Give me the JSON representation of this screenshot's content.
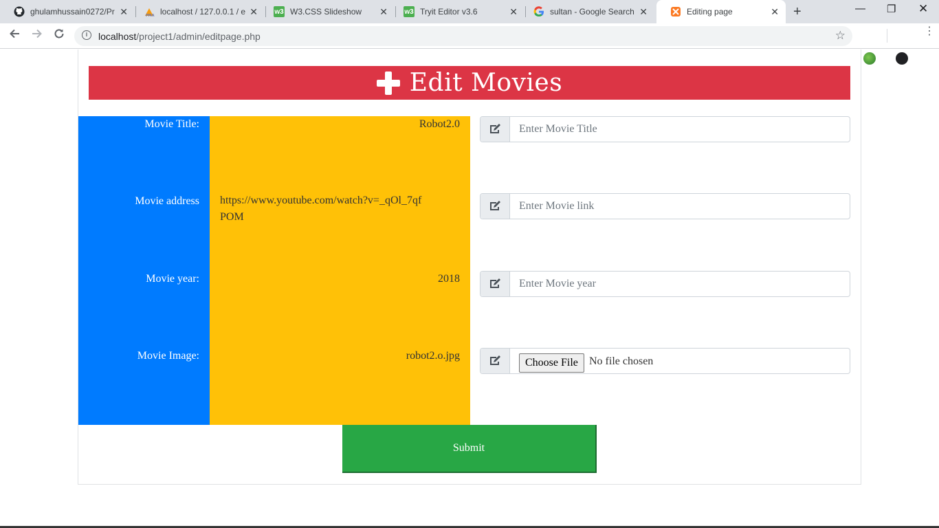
{
  "browser": {
    "tabs": [
      {
        "title": "ghulamhussain0272/Pr",
        "icon": "github-icon"
      },
      {
        "title": "localhost / 127.0.0.1 / e",
        "icon": "phpmyadmin-icon"
      },
      {
        "title": "W3.CSS Slideshow",
        "icon": "w3-icon"
      },
      {
        "title": "Tryit Editor v3.6",
        "icon": "w3-icon"
      },
      {
        "title": "sultan - Google Search",
        "icon": "google-icon"
      },
      {
        "title": "Editing page",
        "icon": "xampp-icon",
        "active": true
      }
    ],
    "url_host": "localhost",
    "url_path": "/project1/admin/editpage.php"
  },
  "page": {
    "heading": "Edit Movies",
    "fields": {
      "title_label": "Movie Title:",
      "title_value": "Robot2.0",
      "title_placeholder": "Enter Movie Title",
      "address_label": "Movie address",
      "address_value": "https://www.youtube.com/watch?v=_qOl_7qfPOM",
      "address_placeholder": "Enter Movie link",
      "year_label": "Movie year:",
      "year_value": "2018",
      "year_placeholder": "Enter Movie year",
      "image_label": "Movie Image:",
      "image_value": "robot2.o.jpg",
      "file_button": "Choose File",
      "file_status": "No file chosen"
    },
    "submit_label": "Submit"
  },
  "colors": {
    "banner": "#dc3545",
    "label_column": "#007bff",
    "value_column": "#ffc107",
    "submit": "#28a745"
  }
}
